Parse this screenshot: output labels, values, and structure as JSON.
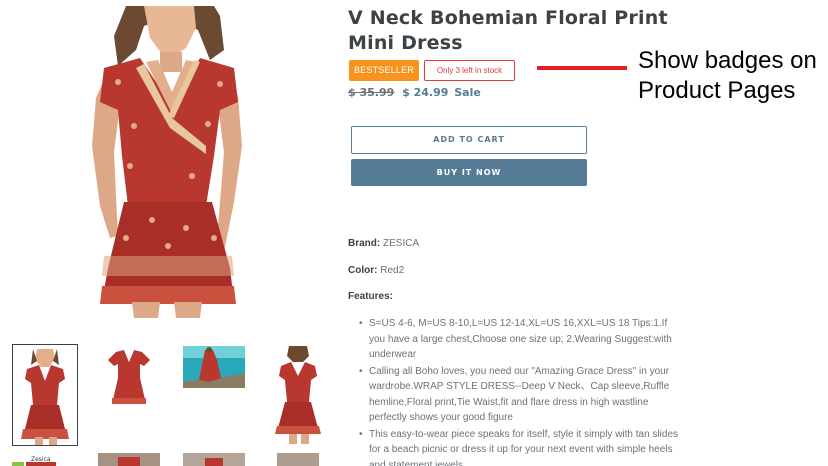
{
  "product": {
    "title_line1": "V Neck Bohemian Floral Print",
    "title_line2": "Mini Dress",
    "badge_bestseller": "BESTSELLER",
    "badge_stock": "Only 3 left in stock",
    "old_price": "$ 35.99",
    "new_price": "$ 24.99",
    "sale_label": "Sale",
    "add_to_cart": "ADD TO CART",
    "buy_now": "BUY IT NOW",
    "brand_label": "Brand:",
    "brand_value": "ZESICA",
    "color_label": "Color:",
    "color_value": "Red2",
    "features_label": "Features:",
    "features": [
      "S=US 4-6, M=US 8-10,L=US 12-14,XL=US 16,XXL=US 18 Tips:1.If you have a large chest,Choose one size up; 2.Wearing Suggest:with underwear",
      "Calling all Boho loves, you need our \"Amazing Grace Dress\" in your wardrobe.WRAP STYLE DRESS--Deep V Neck、Cap sleeve,Ruffle hemline,Floral print,Tie Waist,fit and flare dress in high wastline perfectly shows your good figure",
      "This easy-to-wear piece speaks for itself, style it simply with tan slides for a beach picnic or dress it up for your next event with simple heels and statement jewels."
    ],
    "thumb_brand_text": "Zesica"
  },
  "annotation": {
    "line1": "Show badges on",
    "line2": "Product Pages"
  },
  "colors": {
    "accent": "#557b97",
    "bestseller": "#f7941d",
    "stock": "#e03a3a",
    "annotation_arrow": "#e31e24",
    "dress": "#b8372f"
  }
}
